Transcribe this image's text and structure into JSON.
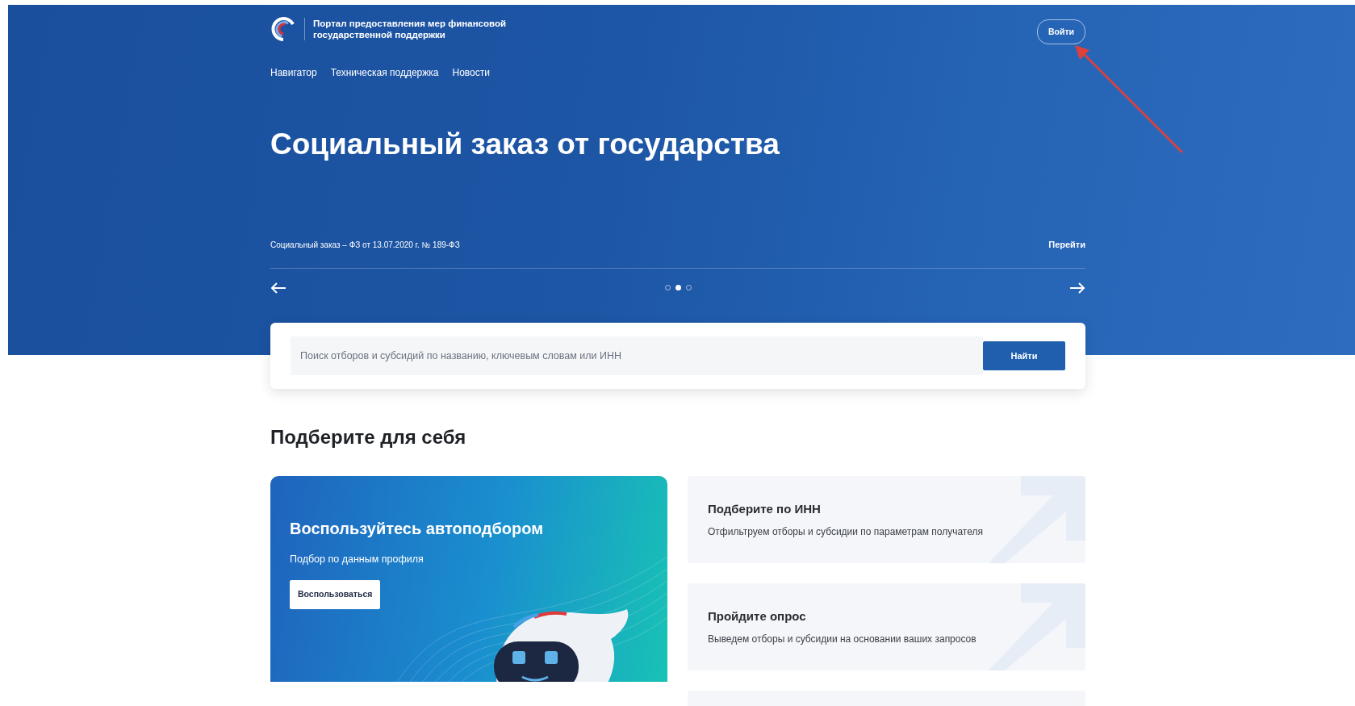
{
  "header": {
    "logo_text": "Портал предоставления мер финансовой\nгосударственной поддержки",
    "login_button": "Войти",
    "nav": [
      {
        "label": "Навигатор"
      },
      {
        "label": "Техническая поддержка"
      },
      {
        "label": "Новости"
      }
    ]
  },
  "hero": {
    "title": "Социальный заказ от государства",
    "caption": "Социальный заказ – ФЗ от 13.07.2020 г. № 189-ФЗ",
    "link": "Перейти",
    "dots": [
      {
        "selected": false
      },
      {
        "selected": true
      },
      {
        "selected": false
      }
    ]
  },
  "search": {
    "placeholder": "Поиск отборов и субсидий по названию, ключевым словам или ИНН",
    "button": "Найти"
  },
  "section_title": "Подберите для себя",
  "promo": {
    "title": "Воспользуйтесь автоподбором",
    "subtitle": "Подбор по данным профиля",
    "button": "Воспользоваться"
  },
  "options": [
    {
      "title": "Подберите по ИНН",
      "description": "Отфильтруем отборы и субсидии по параметрам получателя"
    },
    {
      "title": "Пройдите опрос",
      "description": "Выведем отборы и субсидии на основании ваших запросов"
    }
  ]
}
